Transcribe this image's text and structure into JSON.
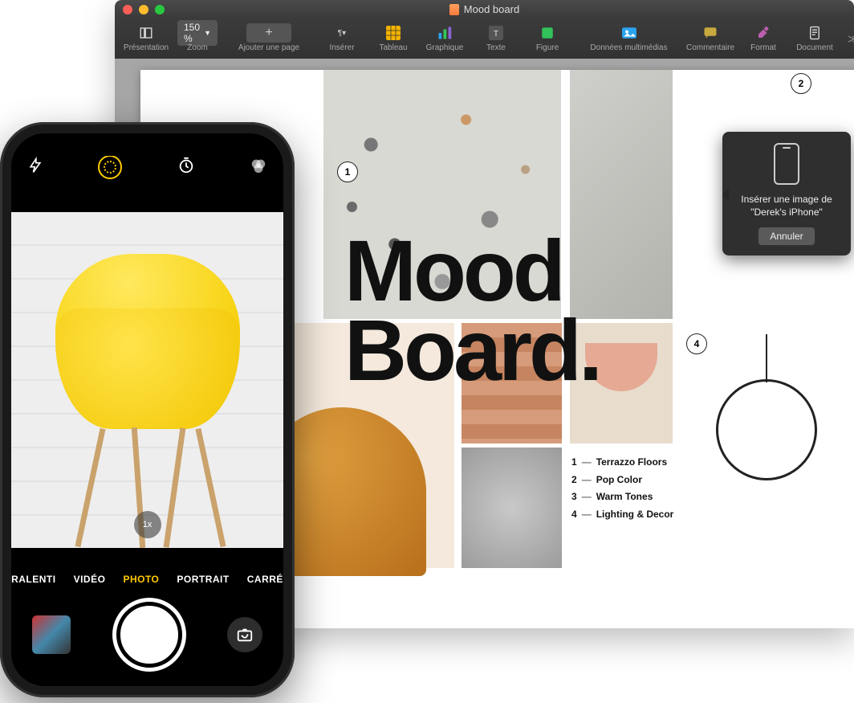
{
  "pages": {
    "title": "Mood board",
    "toolbar": {
      "presentation": "Présentation",
      "zoom_label": "Zoom",
      "zoom_value": "150 %",
      "add_page": "Ajouter une page",
      "insert": "Insérer",
      "table": "Tableau",
      "chart": "Graphique",
      "text": "Texte",
      "shape": "Figure",
      "media": "Données multimédias",
      "comment": "Commentaire",
      "format": "Format",
      "document": "Document"
    },
    "doc": {
      "title_line1": "Mood",
      "title_line2": "Board.",
      "legend": [
        {
          "n": "1",
          "label": "Terrazzo Floors"
        },
        {
          "n": "2",
          "label": "Pop Color"
        },
        {
          "n": "3",
          "label": "Warm Tones"
        },
        {
          "n": "4",
          "label": "Lighting & Decor"
        }
      ],
      "markers": {
        "m1": "1",
        "m2": "2",
        "m4": "4"
      }
    },
    "popover": {
      "text": "Insérer une image de \"Derek's iPhone\"",
      "cancel": "Annuler"
    }
  },
  "iphone": {
    "zoom": "1x",
    "modes": {
      "ralenti": "RALENTI",
      "video": "VIDÉO",
      "photo": "PHOTO",
      "portrait": "PORTRAIT",
      "carre": "CARRÉ"
    }
  }
}
